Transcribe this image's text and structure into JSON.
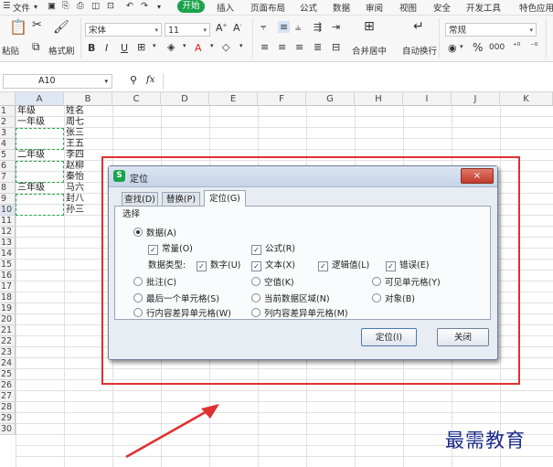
{
  "menubar": {
    "file": "文件",
    "start": "开始",
    "tabs": [
      "插入",
      "页面布局",
      "公式",
      "数据",
      "审阅",
      "视图",
      "安全",
      "开发工具",
      "特色应用"
    ]
  },
  "ribbon": {
    "paste": "粘贴",
    "format_painter": "格式刷",
    "font_name": "宋体",
    "font_size": "11",
    "merge_center": "合并居中",
    "wrap_text": "自动换行",
    "number_format": "常规",
    "percent": "%",
    "comma": "000"
  },
  "formula_bar": {
    "name_box": "A10",
    "fx": "fx",
    "zoom_icon": "magnify-icon"
  },
  "sheet": {
    "columns": [
      "A",
      "B",
      "C",
      "D",
      "E",
      "F",
      "G",
      "H",
      "I",
      "J",
      "K"
    ],
    "rows": [
      "1",
      "2",
      "3",
      "4",
      "5",
      "6",
      "7",
      "8",
      "9",
      "10",
      "11",
      "12",
      "13",
      "14",
      "15",
      "16",
      "17",
      "18",
      "19",
      "20",
      "21",
      "22",
      "23",
      "24",
      "25",
      "26",
      "27",
      "28",
      "29",
      "30"
    ],
    "col_a": [
      "年级",
      "一年级",
      "",
      "",
      "二年级",
      "",
      "",
      "三年级",
      "",
      ""
    ],
    "col_b": [
      "姓名",
      "周七",
      "张三",
      "王五",
      "李四",
      "赵柳",
      "秦怡",
      "马六",
      "封八",
      "孙三"
    ]
  },
  "dialog": {
    "title": "定位",
    "tabs": [
      "查找(D)",
      "替换(P)",
      "定位(G)"
    ],
    "active_tab": "定位(G)",
    "group_label": "选择",
    "data_radio": "数据(A)",
    "constants": "常量(O)",
    "formulas": "公式(R)",
    "data_type_label": "数据类型:",
    "numbers": "数字(U)",
    "text": "文本(X)",
    "logicals": "逻辑值(L)",
    "errors": "错误(E)",
    "comments": "批注(C)",
    "blanks": "空值(K)",
    "visible_cells": "可见单元格(Y)",
    "last_cell": "最后一个单元格(S)",
    "current_region": "当前数据区域(N)",
    "objects": "对象(B)",
    "row_diff": "行内容差异单元格(W)",
    "col_diff": "列内容差异单元格(M)",
    "goto_button": "定位(I)",
    "close_button": "关闭",
    "close_x": "×"
  },
  "watermark": "最需教育",
  "colors": {
    "accent_green": "#1aa34a",
    "highlight_red": "#e03030",
    "dashed_green": "#2ea84a"
  }
}
